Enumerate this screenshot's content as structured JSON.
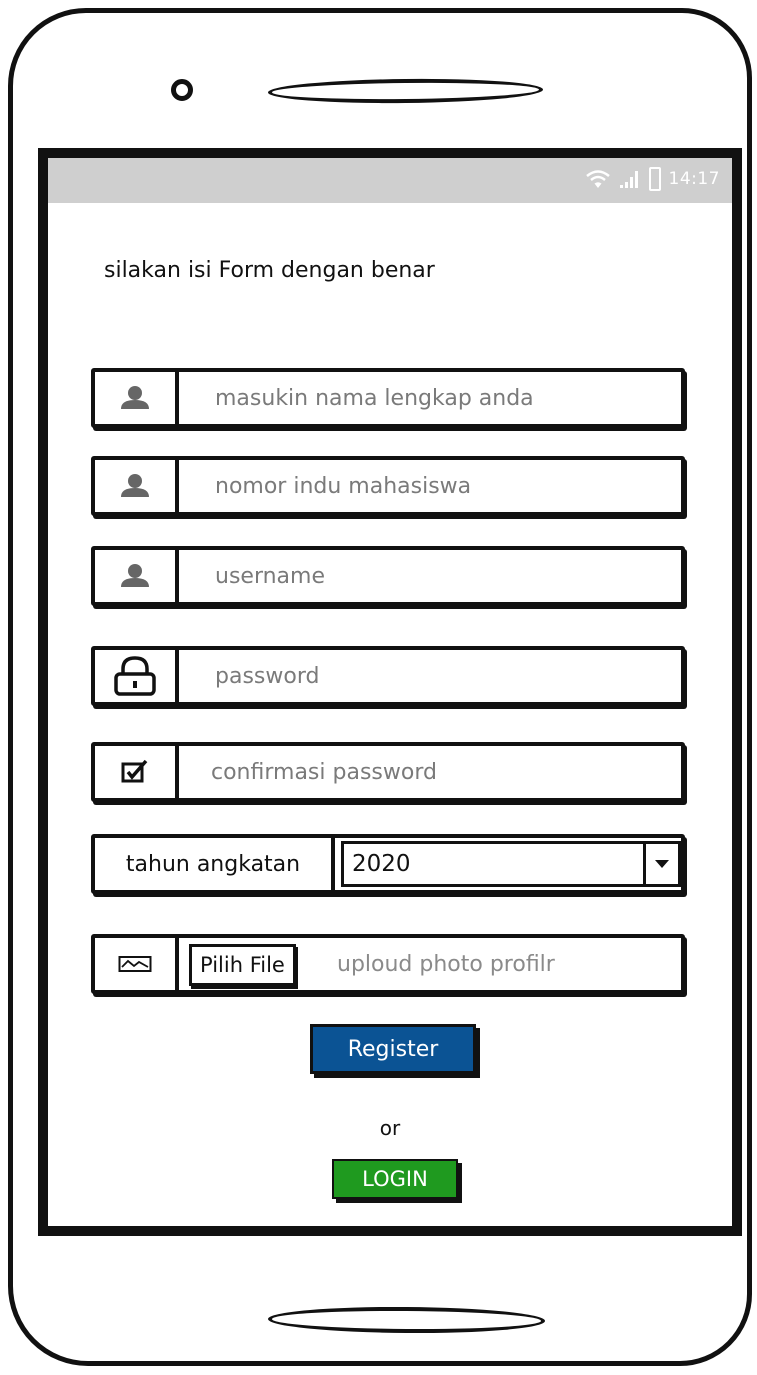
{
  "status_bar": {
    "time": "14:17"
  },
  "form": {
    "title": "silakan isi Form dengan benar",
    "fields": [
      {
        "icon": "user-icon",
        "placeholder": "masukin nama lengkap anda"
      },
      {
        "icon": "user-icon",
        "placeholder": "nomor indu mahasiswa"
      },
      {
        "icon": "user-icon",
        "placeholder": "username"
      },
      {
        "icon": "lock-icon",
        "placeholder": "password"
      },
      {
        "icon": "checkbox-icon",
        "placeholder": "confirmasi password"
      }
    ],
    "year": {
      "label": "tahun angkatan",
      "selected": "2020"
    },
    "photo": {
      "icon": "image-icon",
      "button_label": "Pilih File",
      "placeholder": "uploud photo profilr"
    }
  },
  "actions": {
    "register_label": "Register",
    "or_text": "or",
    "login_label": "LOGIN"
  },
  "colors": {
    "register": "#0b5394",
    "login": "#1f9a1f",
    "status_bar": "#cfcfcf"
  }
}
